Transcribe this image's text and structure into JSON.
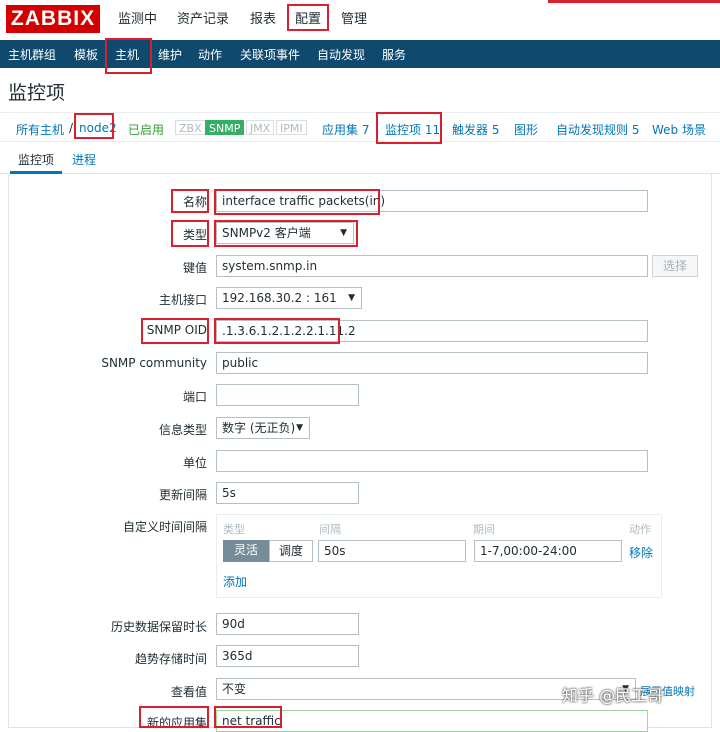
{
  "app": {
    "logo": "ZABBIX"
  },
  "top_menu": [
    "监测中",
    "资产记录",
    "报表",
    "配置",
    "管理"
  ],
  "sub_menu": [
    "主机群组",
    "模板",
    "主机",
    "维护",
    "动作",
    "关联项事件",
    "自动发现",
    "服务"
  ],
  "page_title": "监控项",
  "crumbs": {
    "all_hosts": "所有主机",
    "separator": "/",
    "host": "node2",
    "status": "已启用",
    "tags": [
      "ZBX",
      "SNMP",
      "JMX",
      "IPMI"
    ],
    "app_label": "应用集",
    "app_count": "7",
    "items_label": "监控项",
    "items_count": "11",
    "triggers_label": "触发器",
    "triggers_count": "5",
    "graphs_label": "图形",
    "discovery_label": "自动发现规则",
    "discovery_count": "5",
    "web_label": "Web 场景"
  },
  "tabs": [
    "监控项",
    "进程"
  ],
  "form": {
    "name_label": "名称",
    "name_value": "interface traffic packets(in)",
    "type_label": "类型",
    "type_value": "SNMPv2 客户端",
    "key_label": "键值",
    "key_value": "system.snmp.in",
    "select_button": "选择",
    "interface_label": "主机接口",
    "interface_value": "192.168.30.2 : 161",
    "oid_label": "SNMP OID",
    "oid_value": ".1.3.6.1.2.1.2.2.1.11.2",
    "community_label": "SNMP community",
    "community_value": "public",
    "port_label": "端口",
    "port_value": "",
    "info_type_label": "信息类型",
    "info_type_value": "数字 (无正负)",
    "unit_label": "单位",
    "unit_value": "",
    "interval_label": "更新间隔",
    "interval_value": "5s",
    "custom_label": "自定义时间间隔",
    "custom": {
      "col_type": "类型",
      "col_interval": "间隔",
      "col_period": "期间",
      "col_action": "动作",
      "flex": "灵活",
      "schedule": "调度",
      "interval": "50s",
      "period": "1-7,00:00-24:00",
      "remove": "移除",
      "add": "添加"
    },
    "history_label": "历史数据保留时长",
    "history_value": "90d",
    "trend_label": "趋势存储时间",
    "trend_value": "365d",
    "show_value_label": "查看值",
    "show_value": "不变",
    "show_value_link": "展示值映射",
    "new_app_label": "新的应用集",
    "new_app_value": "net traffic"
  },
  "watermark": "知乎 @民工哥"
}
